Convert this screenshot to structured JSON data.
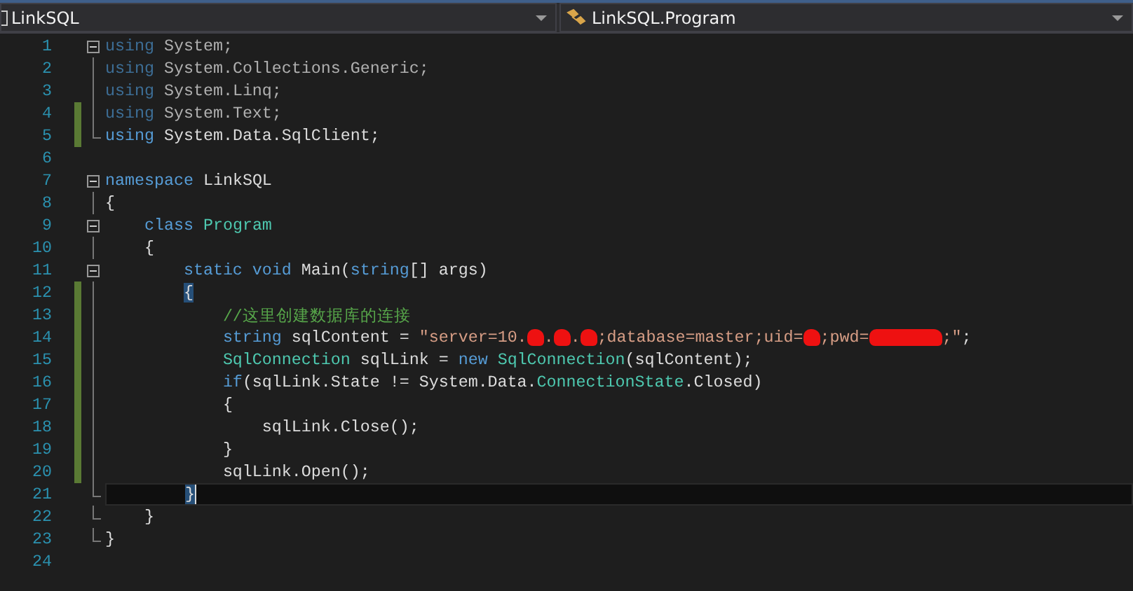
{
  "navigation_bar": {
    "project_dropdown": "LinkSQL",
    "type_dropdown": "LinkSQL.Program"
  },
  "editor": {
    "lines": [
      {
        "number": "1",
        "changed": false,
        "current": false,
        "kind": "fold-start",
        "tokens": [
          {
            "kind": "keyword-dim",
            "text": "using"
          },
          {
            "kind": "plain-dim",
            "text": " System;"
          }
        ]
      },
      {
        "number": "2",
        "changed": false,
        "current": false,
        "kind": "fold-line",
        "tokens": [
          {
            "kind": "keyword-dim",
            "text": "using"
          },
          {
            "kind": "plain-dim",
            "text": " System.Collections.Generic;"
          }
        ]
      },
      {
        "number": "3",
        "changed": false,
        "current": false,
        "kind": "fold-line",
        "tokens": [
          {
            "kind": "keyword-dim",
            "text": "using"
          },
          {
            "kind": "plain-dim",
            "text": " System.Linq;"
          }
        ]
      },
      {
        "number": "4",
        "changed": true,
        "current": false,
        "kind": "fold-line",
        "tokens": [
          {
            "kind": "keyword-dim",
            "text": "using"
          },
          {
            "kind": "plain-dim",
            "text": " System.Text;"
          }
        ]
      },
      {
        "number": "5",
        "changed": true,
        "current": false,
        "kind": "fold-end",
        "tokens": [
          {
            "kind": "keyword",
            "text": "using"
          },
          {
            "kind": "plain",
            "text": " System.Data.SqlClient;"
          }
        ]
      },
      {
        "number": "6",
        "changed": false,
        "current": false,
        "kind": "blank"
      },
      {
        "number": "7",
        "changed": false,
        "current": false,
        "kind": "fold-start",
        "tokens": [
          {
            "kind": "keyword",
            "text": "namespace"
          },
          {
            "kind": "plain",
            "text": " LinkSQL"
          }
        ]
      },
      {
        "number": "8",
        "changed": false,
        "current": false,
        "kind": "fold-line",
        "tokens": [
          {
            "kind": "plain",
            "text": "{"
          }
        ]
      },
      {
        "number": "9",
        "changed": false,
        "current": false,
        "kind": "fold-start",
        "tokens": [
          {
            "kind": "keyword",
            "text": "    class"
          },
          {
            "kind": "type",
            "text": " Program"
          }
        ]
      },
      {
        "number": "10",
        "changed": false,
        "current": false,
        "kind": "fold-line",
        "tokens": [
          {
            "kind": "plain",
            "text": "    {"
          }
        ]
      },
      {
        "number": "11",
        "changed": false,
        "current": false,
        "kind": "fold-start",
        "tokens": [
          {
            "kind": "keyword",
            "text": "        static void"
          },
          {
            "kind": "plain",
            "text": " Main("
          },
          {
            "kind": "keyword",
            "text": "string"
          },
          {
            "kind": "plain",
            "text": "[] args)"
          }
        ]
      },
      {
        "number": "12",
        "changed": true,
        "current": false,
        "kind": "fold-line",
        "tokens": [
          {
            "kind": "brace-match",
            "text": "        {"
          }
        ]
      },
      {
        "number": "13",
        "changed": true,
        "current": false,
        "kind": "fold-line",
        "tokens": [
          {
            "kind": "comment",
            "text": "            //这里创建数据库的连接"
          }
        ]
      },
      {
        "number": "14",
        "changed": true,
        "current": false,
        "kind": "fold-line",
        "tokens": [
          {
            "kind": "keyword",
            "text": "            string"
          },
          {
            "kind": "plain",
            "text": " sqlContent = "
          },
          {
            "kind": "string",
            "text": "\"server=10."
          },
          {
            "kind": "redaction",
            "wide": false
          },
          {
            "kind": "string",
            "text": "."
          },
          {
            "kind": "redaction",
            "wide": false
          },
          {
            "kind": "string",
            "text": "."
          },
          {
            "kind": "redaction",
            "wide": false
          },
          {
            "kind": "string",
            "text": ";database=master;uid="
          },
          {
            "kind": "redaction",
            "wide": false
          },
          {
            "kind": "string",
            "text": ";pwd="
          },
          {
            "kind": "redaction",
            "wide": true
          },
          {
            "kind": "string",
            "text": ";\""
          },
          {
            "kind": "plain",
            "text": ";"
          }
        ]
      },
      {
        "number": "15",
        "changed": true,
        "current": false,
        "kind": "fold-line",
        "tokens": [
          {
            "kind": "type",
            "text": "            SqlConnection"
          },
          {
            "kind": "plain",
            "text": " sqlLink = "
          },
          {
            "kind": "keyword",
            "text": "new"
          },
          {
            "kind": "type",
            "text": " SqlConnection"
          },
          {
            "kind": "plain",
            "text": "(sqlContent);"
          }
        ]
      },
      {
        "number": "16",
        "changed": true,
        "current": false,
        "kind": "fold-line",
        "tokens": [
          {
            "kind": "keyword",
            "text": "            if"
          },
          {
            "kind": "plain",
            "text": "(sqlLink.State != System.Data."
          },
          {
            "kind": "type",
            "text": "ConnectionState"
          },
          {
            "kind": "plain",
            "text": ".Closed)"
          }
        ]
      },
      {
        "number": "17",
        "changed": true,
        "current": false,
        "kind": "fold-line",
        "tokens": [
          {
            "kind": "plain",
            "text": "            {"
          }
        ]
      },
      {
        "number": "18",
        "changed": true,
        "current": false,
        "kind": "fold-line",
        "tokens": [
          {
            "kind": "plain",
            "text": "                sqlLink.Close();"
          }
        ]
      },
      {
        "number": "19",
        "changed": true,
        "current": false,
        "kind": "fold-line",
        "tokens": [
          {
            "kind": "plain",
            "text": "            }"
          }
        ]
      },
      {
        "number": "20",
        "changed": true,
        "current": false,
        "kind": "fold-line",
        "tokens": [
          {
            "kind": "plain",
            "text": "            sqlLink.Open();"
          }
        ]
      },
      {
        "number": "21",
        "changed": false,
        "current": true,
        "kind": "fold-end",
        "tokens": [
          {
            "kind": "brace-match",
            "text": "        }"
          }
        ]
      },
      {
        "number": "22",
        "changed": false,
        "current": false,
        "kind": "fold-end",
        "tokens": [
          {
            "kind": "plain",
            "text": "    }"
          }
        ]
      },
      {
        "number": "23",
        "changed": false,
        "current": false,
        "kind": "fold-end",
        "tokens": [
          {
            "kind": "plain",
            "text": "}"
          }
        ]
      },
      {
        "number": "24",
        "changed": false,
        "current": false,
        "kind": "blank"
      }
    ]
  }
}
